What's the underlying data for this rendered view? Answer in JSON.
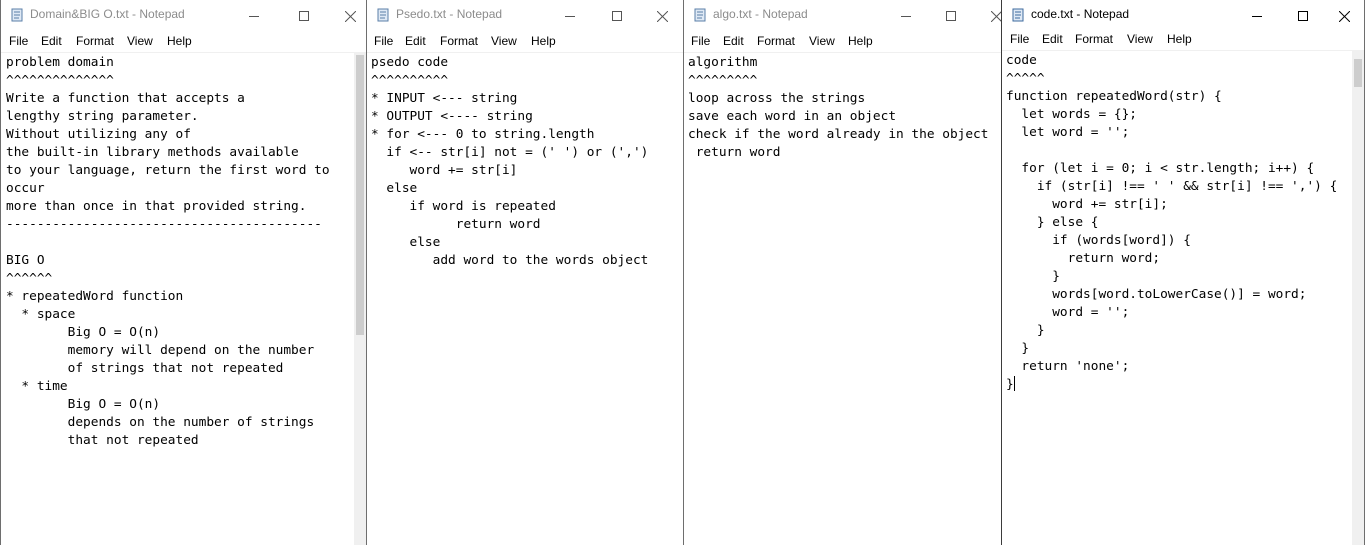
{
  "menu": [
    "File",
    "Edit",
    "Format",
    "View",
    "Help"
  ],
  "windows": [
    {
      "title": "Domain&BIG O.txt - Notepad",
      "content": "problem domain\n^^^^^^^^^^^^^^\nWrite a function that accepts a\nlengthy string parameter.\nWithout utilizing any of\nthe built-in library methods available\nto your language, return the first word to\noccur\nmore than once in that provided string.\n-----------------------------------------\n\nBIG O\n^^^^^^\n* repeatedWord function\n  * space\n        Big O = O(n)\n        memory will depend on the number\n        of strings that not repeated\n  * time\n        Big O = O(n)\n        depends on the number of strings\n        that not repeated"
    },
    {
      "title": "Psedo.txt - Notepad",
      "content": "psedo code\n^^^^^^^^^^\n* INPUT <--- string\n* OUTPUT <---- string\n* for <--- 0 to string.length\n  if <-- str[i] not = (' ') or (',')\n     word += str[i]\n  else\n     if word is repeated\n           return word\n     else\n        add word to the words object"
    },
    {
      "title": "algo.txt - Notepad",
      "content": "algorithm\n^^^^^^^^^\nloop across the strings\nsave each word in an object\ncheck if the word already in the object\n return word"
    },
    {
      "title": "code.txt - Notepad",
      "content": "code\n^^^^^\nfunction repeatedWord(str) {\n  let words = {};\n  let word = '';\n\n  for (let i = 0; i < str.length; i++) {\n    if (str[i] !== ' ' && str[i] !== ',') {\n      word += str[i];\n    } else {\n      if (words[word]) {\n        return word;\n      }\n      words[word.toLowerCase()] = word;\n      word = '';\n    }\n  }\n  return 'none';\n}"
    }
  ]
}
